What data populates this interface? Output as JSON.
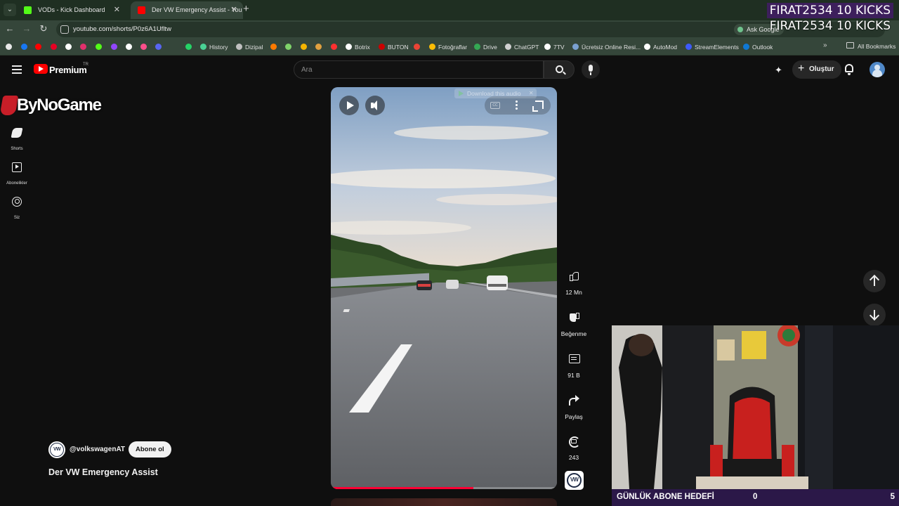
{
  "browser": {
    "tabs": [
      {
        "title": "VODs - Kick Dashboard",
        "favicon_color": "#53fc18",
        "active": false
      },
      {
        "title": "Der VW Emergency Assist - You",
        "favicon_color": "#ff0000",
        "active": true
      }
    ],
    "url": "youtube.com/shorts/P0z6A1Ufltw",
    "ask_google": "Ask Google",
    "bookmarks": [
      {
        "label": "",
        "color": "#e8e8e8"
      },
      {
        "label": "",
        "color": "#1877f2"
      },
      {
        "label": "",
        "color": "#ff0000"
      },
      {
        "label": "",
        "color": "#e60023"
      },
      {
        "label": "",
        "color": "#ffffff"
      },
      {
        "label": "",
        "color": "#e1306c"
      },
      {
        "label": "",
        "color": "#53fc18"
      },
      {
        "label": "",
        "color": "#9146ff"
      },
      {
        "label": "",
        "color": "#ffffff"
      },
      {
        "label": "",
        "color": "#ff4f8b"
      },
      {
        "label": "",
        "color": "#5865f2"
      },
      {
        "label": "",
        "color": "#25d366"
      },
      {
        "label": "History",
        "color": "#4ad295"
      },
      {
        "label": "Dizipal",
        "color": "#c0c0c0"
      },
      {
        "label": "",
        "color": "#ff7a00"
      },
      {
        "label": "",
        "color": "#f4b400"
      },
      {
        "label": "",
        "color": "#7fd36a"
      },
      {
        "label": "",
        "color": "#e0a040"
      },
      {
        "label": "",
        "color": "#ff3030"
      },
      {
        "label": "Botrix",
        "color": "#ffffff"
      },
      {
        "label": "BUTON",
        "color": "#cc0000"
      },
      {
        "label": "",
        "color": "#ea4335"
      },
      {
        "label": "Fotoğraflar",
        "color": "#fbbc04"
      },
      {
        "label": "Drive",
        "color": "#34a853"
      },
      {
        "label": "ChatGPT",
        "color": "#d0d0d0"
      },
      {
        "label": "7TV",
        "color": "#ffffff"
      },
      {
        "label": "Ücretsiz Online Resi...",
        "color": "#7aa0d0"
      },
      {
        "label": "AutoMod",
        "color": "#ffffff"
      },
      {
        "label": "StreamElements",
        "color": "#3d5afe"
      },
      {
        "label": "Outlook",
        "color": "#0f78d4"
      }
    ],
    "all_bookmarks": "All Bookmarks"
  },
  "stream_alert": {
    "line1": "FIRAT2534  10 KICKS",
    "line2": "FIRAT2534  10 KICKS"
  },
  "streamer_logo": "ByNoGame",
  "youtube": {
    "brand": "Premium",
    "country": "TR",
    "search_placeholder": "Ara",
    "create_label": "Oluştur",
    "sidebar": [
      {
        "label": "Shorts",
        "icon": "shorts-icon"
      },
      {
        "label": "Abonelikler",
        "icon": "subscriptions-icon"
      },
      {
        "label": "Siz",
        "icon": "you-icon"
      }
    ]
  },
  "short": {
    "download_audio": "Download this audio",
    "progress": 0.63,
    "actions": {
      "likes": "12 Mn",
      "dislike": "Beğenme",
      "comments": "91 B",
      "share": "Paylaş",
      "remix": "243"
    },
    "channel": "@volkswagenAT",
    "subscribe": "Abone ol",
    "title": "Der VW Emergency Assist"
  },
  "overlay": {
    "goal_label": "GÜNLÜK ABONE HEDEFİ",
    "goal_current": "0",
    "goal_target": "5"
  },
  "colors": {
    "yt_red": "#ff0000",
    "progress": "#ff0033",
    "goal_bar": "#2b1848",
    "alert_bg": "#3d1f5c"
  }
}
